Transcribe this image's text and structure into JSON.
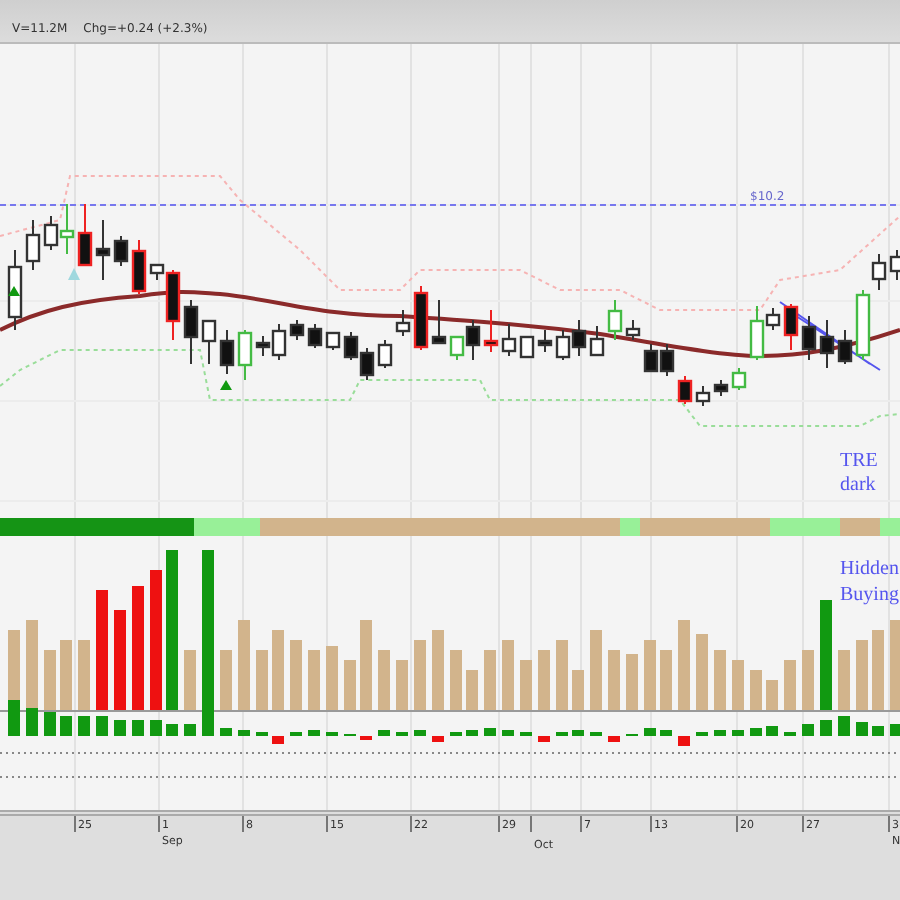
{
  "header": {
    "volume": "V=11.2M",
    "change": "Chg=+0.24 (+2.3%)"
  },
  "price_chart": {
    "line_label": "$10.2",
    "notes": [
      "TRE",
      "dark"
    ]
  },
  "volume_chart": {
    "notes": [
      "Hidden",
      "Buying"
    ]
  },
  "time_axis": {
    "ticks": [
      {
        "label": "25"
      },
      {
        "label": "1",
        "month": "Sep"
      },
      {
        "label": "8"
      },
      {
        "label": "15"
      },
      {
        "label": "22"
      },
      {
        "label": "29"
      },
      {
        "month": "Oct"
      },
      {
        "label": "7"
      },
      {
        "label": "13"
      },
      {
        "label": "20"
      },
      {
        "label": "27"
      },
      {
        "label": "3",
        "month": "N"
      }
    ]
  }
}
